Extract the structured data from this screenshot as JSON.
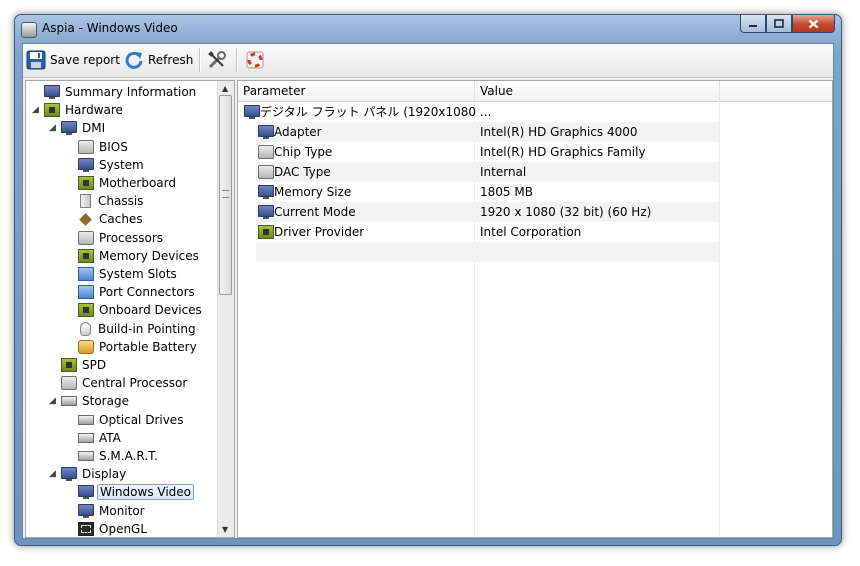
{
  "window": {
    "title": "Aspia - Windows Video",
    "app_icon": "aspia-app-icon",
    "caption": {
      "minimize_icon": "minimize-icon",
      "maximize_icon": "maximize-icon",
      "close_icon": "close-icon"
    }
  },
  "toolbar": {
    "save_label": "Save report",
    "save_icon": "floppy-disk-icon",
    "refresh_label": "Refresh",
    "refresh_icon": "refresh-icon",
    "settings_icon": "tools-icon",
    "help_icon": "lifebuoy-icon"
  },
  "tree": {
    "items": [
      {
        "label": "Summary Information",
        "icon": "monitor-icon",
        "level": 0
      },
      {
        "label": "Hardware",
        "icon": "board-icon",
        "level": 0,
        "expanded": true
      },
      {
        "label": "DMI",
        "icon": "monitor-icon",
        "level": 1,
        "expanded": true
      },
      {
        "label": "BIOS",
        "icon": "chip-icon",
        "level": 2
      },
      {
        "label": "System",
        "icon": "monitor-icon",
        "level": 2
      },
      {
        "label": "Motherboard",
        "icon": "board-icon",
        "level": 2
      },
      {
        "label": "Chassis",
        "icon": "case-icon",
        "level": 2
      },
      {
        "label": "Caches",
        "icon": "cache-icon",
        "level": 2
      },
      {
        "label": "Processors",
        "icon": "chip-icon",
        "level": 2
      },
      {
        "label": "Memory Devices",
        "icon": "board-icon",
        "level": 2
      },
      {
        "label": "System Slots",
        "icon": "slot-icon",
        "level": 2
      },
      {
        "label": "Port Connectors",
        "icon": "slot-icon",
        "level": 2
      },
      {
        "label": "Onboard Devices",
        "icon": "board-icon",
        "level": 2
      },
      {
        "label": "Build-in Pointing",
        "icon": "mouse-icon",
        "level": 2
      },
      {
        "label": "Portable Battery",
        "icon": "battery-icon",
        "level": 2
      },
      {
        "label": "SPD",
        "icon": "board-icon",
        "level": 1
      },
      {
        "label": "Central Processor",
        "icon": "chip-icon",
        "level": 1
      },
      {
        "label": "Storage",
        "icon": "drive-icon",
        "level": 1,
        "expanded": true
      },
      {
        "label": "Optical Drives",
        "icon": "drive-icon",
        "level": 2
      },
      {
        "label": "ATA",
        "icon": "drive-icon",
        "level": 2
      },
      {
        "label": "S.M.A.R.T.",
        "icon": "drive-icon",
        "level": 2
      },
      {
        "label": "Display",
        "icon": "monitor-icon",
        "level": 1,
        "expanded": true
      },
      {
        "label": "Windows Video",
        "icon": "monitor-icon",
        "level": 2,
        "selected": true
      },
      {
        "label": "Monitor",
        "icon": "monitor-icon",
        "level": 2
      },
      {
        "label": "OpenGL",
        "icon": "opengl-icon",
        "level": 2
      }
    ]
  },
  "list": {
    "columns": [
      "Parameter",
      "Value"
    ],
    "group": {
      "label": "デジタル フラット パネル (1920x1080 ...",
      "icon": "monitor-icon"
    },
    "rows": [
      {
        "param": "Adapter",
        "value": "Intel(R) HD Graphics 4000",
        "icon": "monitor-icon"
      },
      {
        "param": "Chip Type",
        "value": "Intel(R) HD Graphics Family",
        "icon": "chip-icon"
      },
      {
        "param": "DAC Type",
        "value": "Internal",
        "icon": "chip-icon"
      },
      {
        "param": "Memory Size",
        "value": "1805 MB",
        "icon": "monitor-icon"
      },
      {
        "param": "Current Mode",
        "value": "1920 x 1080 (32 bit) (60 Hz)",
        "icon": "monitor-icon"
      },
      {
        "param": "Driver Provider",
        "value": "Intel Corporation",
        "icon": "board-icon"
      }
    ]
  },
  "colors": {
    "title_bar": "#8fb0d6",
    "selection": "#d7e7fb",
    "close_button": "#c7482f"
  }
}
